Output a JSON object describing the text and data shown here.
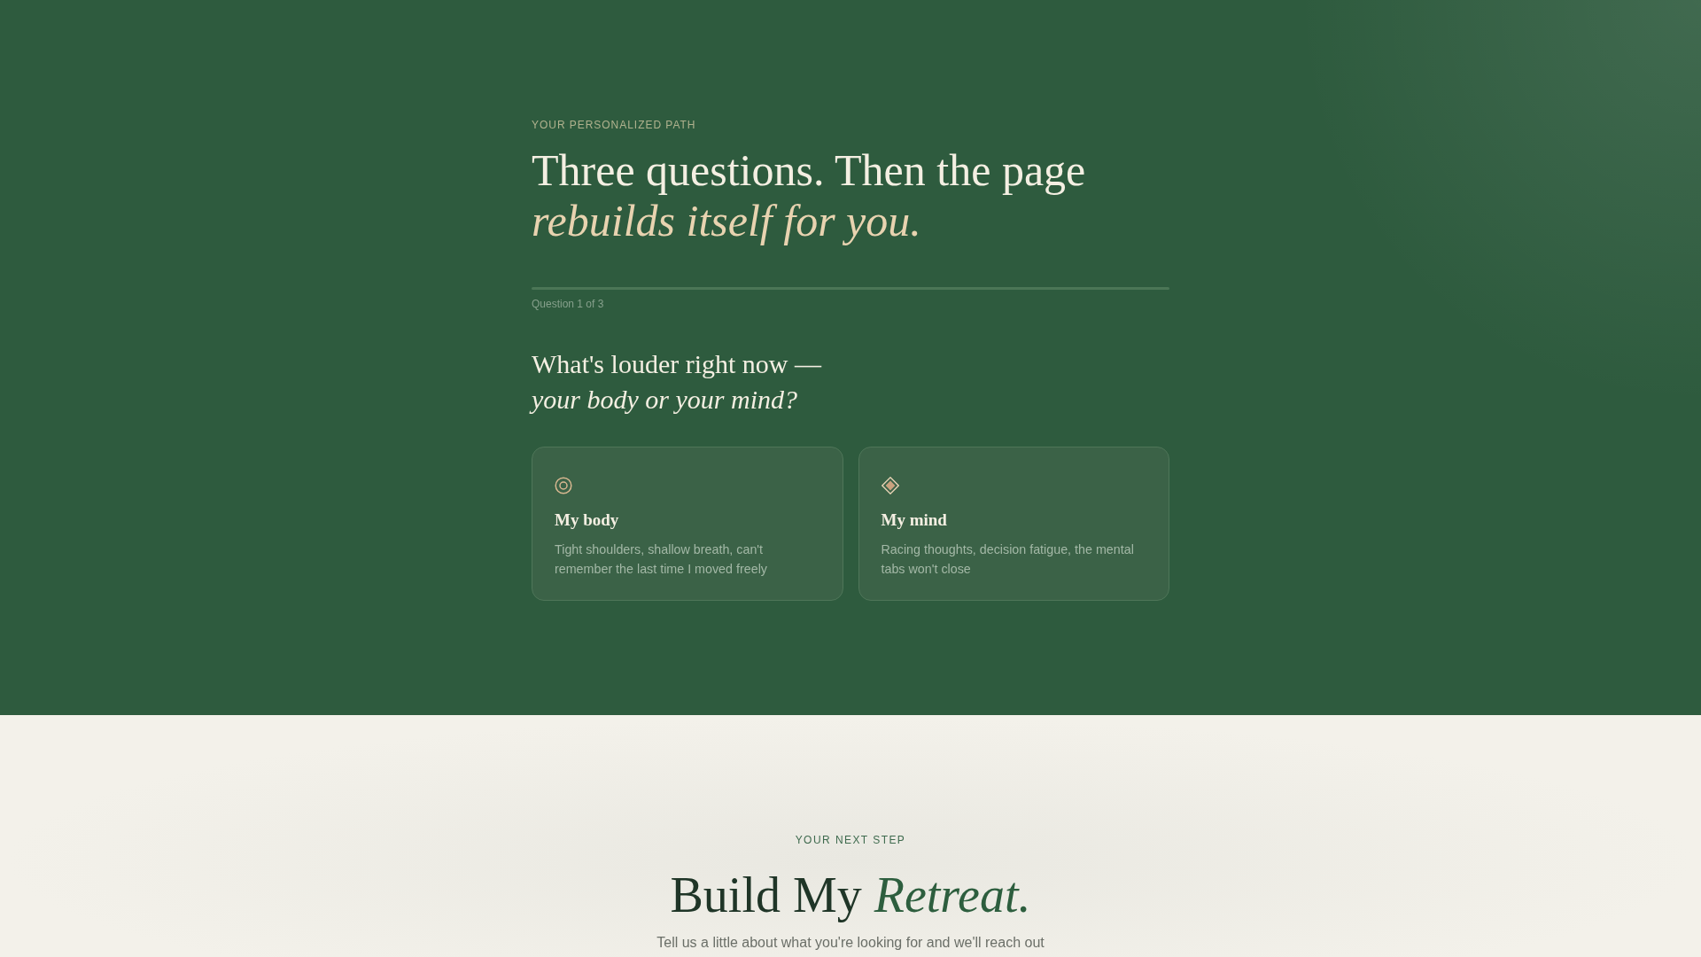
{
  "intro": {
    "eyebrow": "YOUR PERSONALIZED PATH",
    "heading": "Three questions. Then the page *rebuilds itself for you.*"
  },
  "progress": {
    "label": "Question 1 of 3"
  },
  "question": {
    "text": "What's louder right now — *your body or your mind?*"
  },
  "options": [
    {
      "title": "My body",
      "description": "Tight shoulders, shallow breath, can't remember the last time I moved freely",
      "selected": false
    },
    {
      "title": "My mind",
      "description": "Racing thoughts, decision fatigue, the mental tabs won't close",
      "selected": false
    }
  ],
  "next_step": {
    "eyebrow": "YOUR NEXT STEP",
    "heading": "Build My *Retreat.*",
    "description": "Tell us a little about what you're looking for and we'll reach out"
  }
}
